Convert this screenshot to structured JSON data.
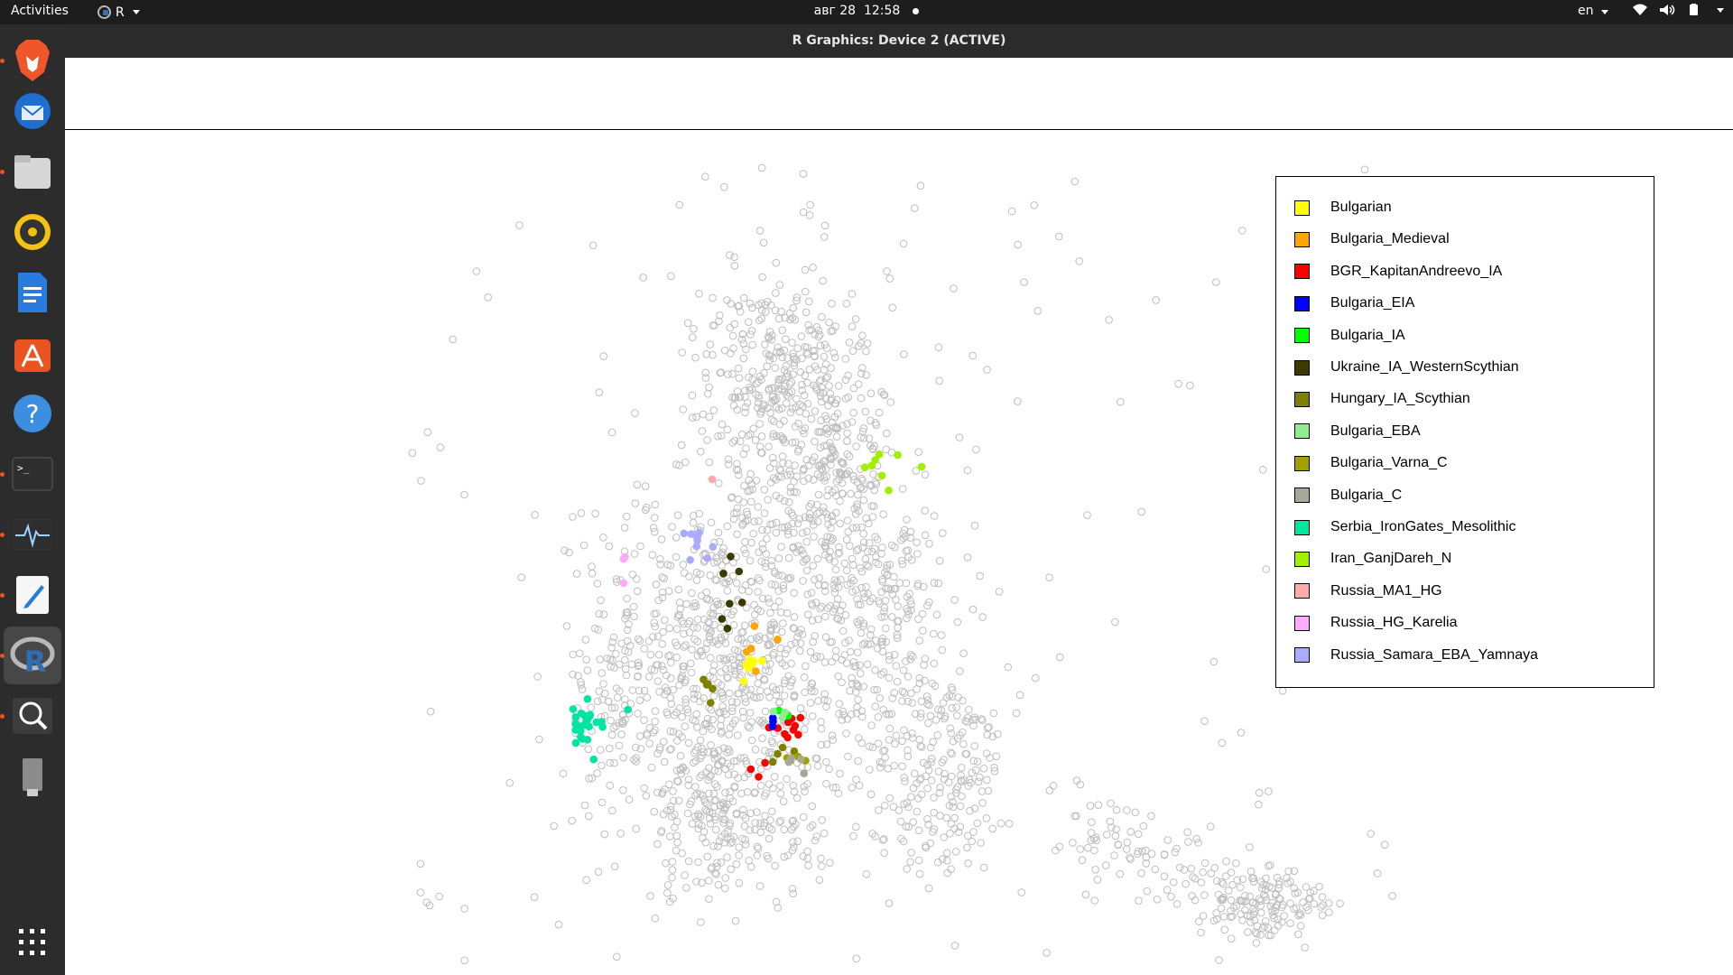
{
  "topbar": {
    "activities": "Activities",
    "app_name": "R",
    "clock": "авг 28  12:58",
    "language": "en"
  },
  "window": {
    "title": "R Graphics: Device 2 (ACTIVE)"
  },
  "dock": {
    "items": [
      {
        "name": "brave-browser-icon",
        "running": true
      },
      {
        "name": "thunderbird-mail-icon",
        "running": false
      },
      {
        "name": "files-icon",
        "running": true
      },
      {
        "name": "rhythmbox-icon",
        "running": false
      },
      {
        "name": "libreoffice-writer-icon",
        "running": false
      },
      {
        "name": "ubuntu-software-icon",
        "running": false
      },
      {
        "name": "help-icon",
        "running": false
      },
      {
        "name": "terminal-icon",
        "running": true
      },
      {
        "name": "system-monitor-icon",
        "running": true
      },
      {
        "name": "text-editor-icon",
        "running": true
      },
      {
        "name": "r-app-icon",
        "running": true
      },
      {
        "name": "image-viewer-icon",
        "running": true
      },
      {
        "name": "usb-drive-icon",
        "running": false
      }
    ],
    "show_apps": "show-applications-icon"
  },
  "chart_data": {
    "type": "scatter",
    "background_points": {
      "color": "#bebebe",
      "style": "open-circle"
    },
    "legend_position": "top-right",
    "legend": [
      {
        "label": "Bulgarian",
        "color": "#ffff00"
      },
      {
        "label": "Bulgaria_Medieval",
        "color": "#ffa500"
      },
      {
        "label": "BGR_KapitanAndreevo_IA",
        "color": "#ff0000"
      },
      {
        "label": "Bulgaria_EIA",
        "color": "#0000ff"
      },
      {
        "label": "Bulgaria_IA",
        "color": "#00ff00"
      },
      {
        "label": "Ukraine_IA_WesternScythian",
        "color": "#3b3b00"
      },
      {
        "label": "Hungary_IA_Scythian",
        "color": "#808000"
      },
      {
        "label": "Bulgaria_EBA",
        "color": "#90ee90"
      },
      {
        "label": "Bulgaria_Varna_C",
        "color": "#a0a000"
      },
      {
        "label": "Bulgaria_C",
        "color": "#a8a898"
      },
      {
        "label": "Serbia_IronGates_Mesolithic",
        "color": "#00e5a0"
      },
      {
        "label": "Iran_GanjDareh_N",
        "color": "#a0f000"
      },
      {
        "label": "Russia_MA1_HG",
        "color": "#ffaaaa"
      },
      {
        "label": "Russia_HG_Karelia",
        "color": "#ffaaff"
      },
      {
        "label": "Russia_Samara_EBA_Yamnaya",
        "color": "#aaaaff"
      }
    ]
  }
}
